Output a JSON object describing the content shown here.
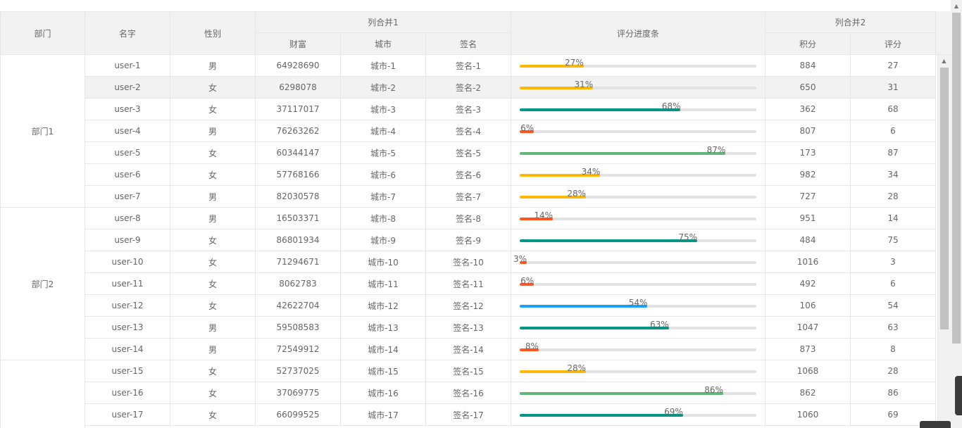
{
  "header": {
    "dept": "部门",
    "name": "名字",
    "gender": "性别",
    "merge1": "列合并1",
    "wealth": "财富",
    "city": "城市",
    "sign": "签名",
    "progress": "评分进度条",
    "merge2": "列合并2",
    "points": "积分",
    "score": "评分"
  },
  "departments": [
    {
      "label": "部门1"
    },
    {
      "label": "部门2"
    },
    {
      "label": ""
    }
  ],
  "colors": {
    "orange": "#FFB800",
    "teal": "#009688",
    "red": "#FF5722",
    "green": "#5FB878",
    "blue": "#1E9FFF",
    "track": "#e2e2e2",
    "header_bg": "#f2f2f2"
  },
  "rows": [
    {
      "name": "user-1",
      "gender": "男",
      "wealth": "64928690",
      "city": "城市-1",
      "sign": "签名-1",
      "progress": 27,
      "progress_label": "27%",
      "color": "#FFB800",
      "points": "884",
      "score": "27"
    },
    {
      "name": "user-2",
      "gender": "女",
      "wealth": "6298078",
      "city": "城市-2",
      "sign": "签名-2",
      "progress": 31,
      "progress_label": "31%",
      "color": "#FFB800",
      "points": "650",
      "score": "31"
    },
    {
      "name": "user-3",
      "gender": "女",
      "wealth": "37117017",
      "city": "城市-3",
      "sign": "签名-3",
      "progress": 68,
      "progress_label": "68%",
      "color": "#009688",
      "points": "362",
      "score": "68"
    },
    {
      "name": "user-4",
      "gender": "男",
      "wealth": "76263262",
      "city": "城市-4",
      "sign": "签名-4",
      "progress": 6,
      "progress_label": "6%",
      "color": "#FF5722",
      "points": "807",
      "score": "6"
    },
    {
      "name": "user-5",
      "gender": "女",
      "wealth": "60344147",
      "city": "城市-5",
      "sign": "签名-5",
      "progress": 87,
      "progress_label": "87%",
      "color": "#5FB878",
      "points": "173",
      "score": "87"
    },
    {
      "name": "user-6",
      "gender": "女",
      "wealth": "57768166",
      "city": "城市-6",
      "sign": "签名-6",
      "progress": 34,
      "progress_label": "34%",
      "color": "#FFB800",
      "points": "982",
      "score": "34"
    },
    {
      "name": "user-7",
      "gender": "男",
      "wealth": "82030578",
      "city": "城市-7",
      "sign": "签名-7",
      "progress": 28,
      "progress_label": "28%",
      "color": "#FFB800",
      "points": "727",
      "score": "28"
    },
    {
      "name": "user-8",
      "gender": "男",
      "wealth": "16503371",
      "city": "城市-8",
      "sign": "签名-8",
      "progress": 14,
      "progress_label": "14%",
      "color": "#FF5722",
      "points": "951",
      "score": "14"
    },
    {
      "name": "user-9",
      "gender": "女",
      "wealth": "86801934",
      "city": "城市-9",
      "sign": "签名-9",
      "progress": 75,
      "progress_label": "75%",
      "color": "#009688",
      "points": "484",
      "score": "75"
    },
    {
      "name": "user-10",
      "gender": "女",
      "wealth": "71294671",
      "city": "城市-10",
      "sign": "签名-10",
      "progress": 3,
      "progress_label": "3%",
      "color": "#FF5722",
      "points": "1016",
      "score": "3"
    },
    {
      "name": "user-11",
      "gender": "女",
      "wealth": "8062783",
      "city": "城市-11",
      "sign": "签名-11",
      "progress": 6,
      "progress_label": "6%",
      "color": "#FF5722",
      "points": "492",
      "score": "6"
    },
    {
      "name": "user-12",
      "gender": "女",
      "wealth": "42622704",
      "city": "城市-12",
      "sign": "签名-12",
      "progress": 54,
      "progress_label": "54%",
      "color": "#1E9FFF",
      "points": "106",
      "score": "54"
    },
    {
      "name": "user-13",
      "gender": "男",
      "wealth": "59508583",
      "city": "城市-13",
      "sign": "签名-13",
      "progress": 63,
      "progress_label": "63%",
      "color": "#009688",
      "points": "1047",
      "score": "63"
    },
    {
      "name": "user-14",
      "gender": "男",
      "wealth": "72549912",
      "city": "城市-14",
      "sign": "签名-14",
      "progress": 8,
      "progress_label": "8%",
      "color": "#FF5722",
      "points": "873",
      "score": "8"
    },
    {
      "name": "user-15",
      "gender": "女",
      "wealth": "52737025",
      "city": "城市-15",
      "sign": "签名-15",
      "progress": 28,
      "progress_label": "28%",
      "color": "#FFB800",
      "points": "1068",
      "score": "28"
    },
    {
      "name": "user-16",
      "gender": "女",
      "wealth": "37069775",
      "city": "城市-16",
      "sign": "签名-16",
      "progress": 86,
      "progress_label": "86%",
      "color": "#5FB878",
      "points": "862",
      "score": "86"
    },
    {
      "name": "user-17",
      "gender": "女",
      "wealth": "66099525",
      "city": "城市-17",
      "sign": "签名-17",
      "progress": 69,
      "progress_label": "69%",
      "color": "#009688",
      "points": "1060",
      "score": "69"
    }
  ],
  "highlighted_row": 2
}
